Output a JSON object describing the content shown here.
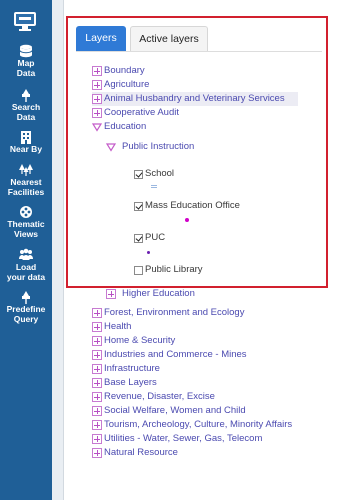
{
  "sidebar": {
    "items": [
      {
        "label": "Map\nData",
        "icon": "database-icon"
      },
      {
        "label": "Search\nData",
        "icon": "pin-icon"
      },
      {
        "label": "Near By",
        "icon": "building-icon"
      },
      {
        "label": "Nearest\nFacilities",
        "icon": "trees-icon"
      },
      {
        "label": "Thematic\nViews",
        "icon": "palette-icon"
      },
      {
        "label": "Load\nyour data",
        "icon": "users-icon"
      },
      {
        "label": "Predefine\nQuery",
        "icon": "pin-icon"
      }
    ]
  },
  "tabs": {
    "layers": "Layers",
    "active": "Active layers"
  },
  "tree": {
    "top": [
      "Boundary",
      "Agriculture",
      "Animal Husbandry and Veterinary Services",
      "Cooperative Audit"
    ],
    "education": "Education",
    "public_instruction": "Public Instruction",
    "school": "School",
    "mass_education": "Mass Education Office",
    "puc": "PUC",
    "public_library": "Public Library",
    "higher_education": "Higher Education",
    "bottom": [
      "Forest, Environment and Ecology",
      "Health",
      "Home & Security",
      "Industries and Commerce - Mines",
      "Infrastructure",
      "Base Layers",
      "Revenue, Disaster, Excise",
      "Social Welfare, Women and Child",
      "Tourism, Archeology, Culture, Minority Affairs",
      "Utilities - Water, Sewer, Gas, Telecom",
      "Natural Resource"
    ]
  },
  "colors": {
    "rail": "#1f5f97",
    "accent": "#2f7ad6",
    "highlight": "#d2202e",
    "tree_text": "#4b4ab0",
    "legend_dot": "#d100c8"
  }
}
